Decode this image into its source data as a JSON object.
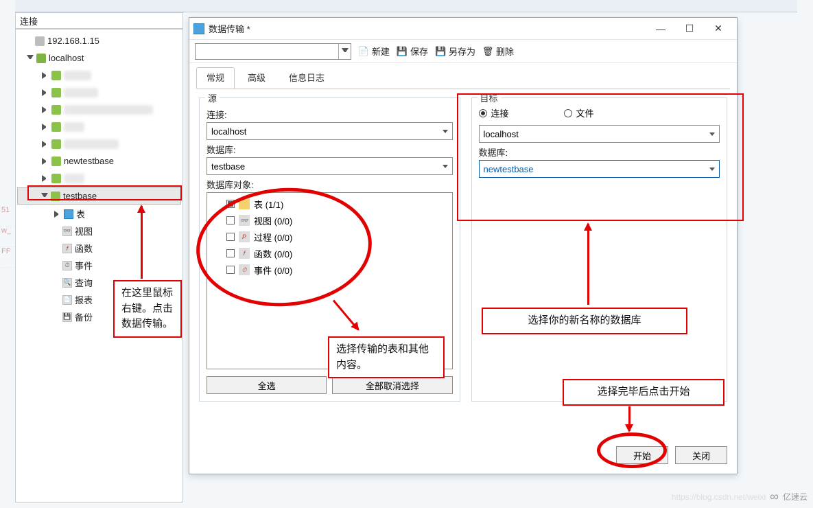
{
  "header": {
    "connections_label": "连接"
  },
  "sidebar": {
    "ip_node": "192.168.1.15",
    "localhost": "localhost",
    "newtestbase": "newtestbase",
    "testbase": "testbase",
    "children": {
      "table": "表",
      "view": "视图",
      "function": "函数",
      "event": "事件",
      "query": "查询",
      "report": "报表",
      "backup": "备份"
    }
  },
  "dialog": {
    "title": "数据传输 *",
    "toolbar": {
      "new": "新建",
      "save": "保存",
      "saveas": "另存为",
      "delete": "删除"
    },
    "tabs": {
      "general": "常规",
      "advanced": "高级",
      "log": "信息日志"
    },
    "source": {
      "legend": "源",
      "conn_label": "连接:",
      "conn_value": "localhost",
      "db_label": "数据库:",
      "db_value": "testbase",
      "obj_label": "数据库对象:",
      "objects": {
        "tables": "表  (1/1)",
        "views": "视图  (0/0)",
        "procs": "过程  (0/0)",
        "funcs": "函数  (0/0)",
        "events": "事件  (0/0)"
      },
      "select_all": "全选",
      "deselect_all": "全部取消选择"
    },
    "target": {
      "legend": "目标",
      "radio_conn": "连接",
      "radio_file": "文件",
      "conn_value": "localhost",
      "db_label": "数据库:",
      "db_value": "newtestbase"
    },
    "actions": {
      "start": "开始",
      "close": "关闭"
    }
  },
  "annotations": {
    "sidebar_note": "在这里鼠标右键。点击数据传输。",
    "source_note": "选择传输的表和其他内容。",
    "target_note": "选择你的新名称的数据库",
    "start_note": "选择完毕后点击开始"
  },
  "watermark": {
    "brand": "亿速云",
    "csdn": "https://blog.csdn.net/weixi"
  }
}
